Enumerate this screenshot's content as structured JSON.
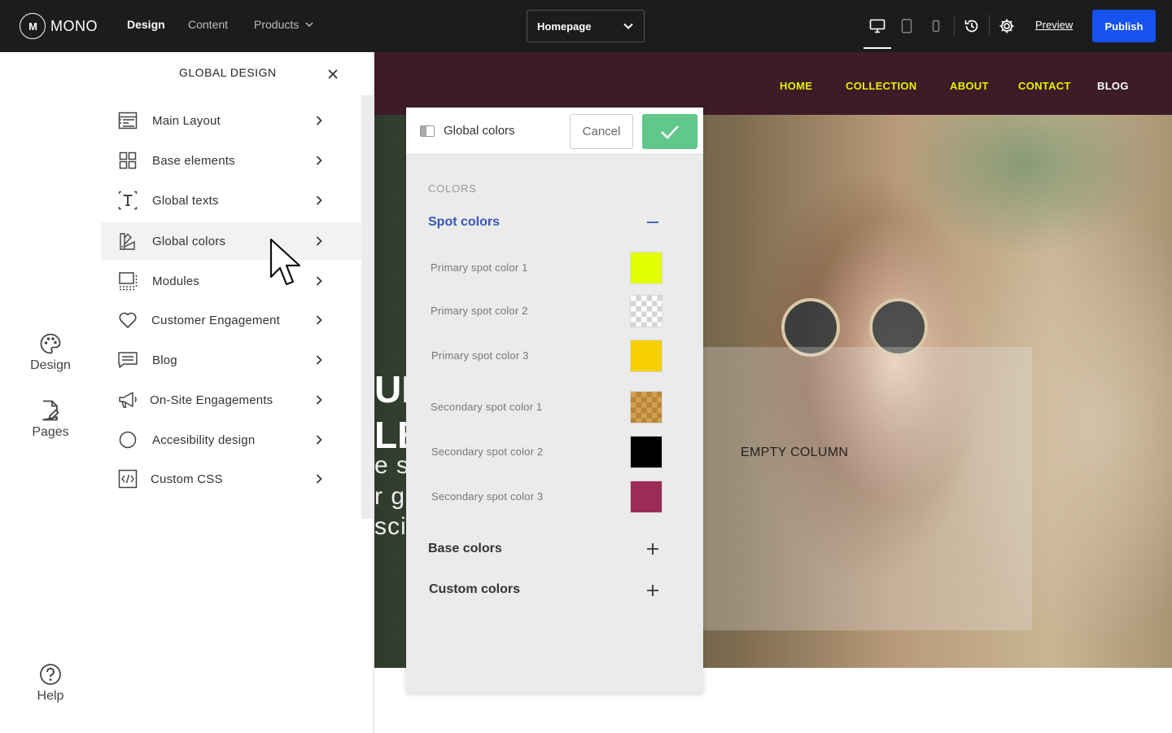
{
  "topbar": {
    "logo_mark": "M",
    "logo_text": "MONO",
    "tabs": [
      {
        "label": "Design",
        "active": true
      },
      {
        "label": "Content",
        "active": false
      },
      {
        "label": "Products",
        "active": false
      }
    ],
    "page_select_value": "Homepage",
    "devices": [
      "desktop-icon",
      "tablet-icon",
      "mobile-icon"
    ],
    "active_device": "desktop",
    "history_icon": "history-icon",
    "settings_icon": "gear-icon",
    "preview_label": "Preview",
    "publish_label": "Publish",
    "publish_color": "#1652f0"
  },
  "rail": {
    "design_label": "Design",
    "pages_label": "Pages",
    "help_label": "Help"
  },
  "global_design": {
    "title": "GLOBAL DESIGN",
    "items": [
      {
        "label": "Main Layout",
        "icon": "layout-icon"
      },
      {
        "label": "Base elements",
        "icon": "grid-icon"
      },
      {
        "label": "Global texts",
        "icon": "text-icon"
      },
      {
        "label": "Global colors",
        "icon": "color-swatch-icon",
        "active": true
      },
      {
        "label": "Modules",
        "icon": "modules-icon"
      },
      {
        "label": "Customer Engagement",
        "icon": "heart-icon"
      },
      {
        "label": "Blog",
        "icon": "chat-icon"
      },
      {
        "label": "On-Site Engagements",
        "icon": "megaphone-icon"
      },
      {
        "label": "Accesibility design",
        "icon": "circle-icon"
      },
      {
        "label": "Custom CSS",
        "icon": "code-icon"
      }
    ]
  },
  "site": {
    "nav": [
      "HOME",
      "COLLECTION",
      "ABOUT",
      "CONTACT",
      "BLOG"
    ],
    "nav_color": "#e2f400",
    "header_color": "#3d1b27",
    "hero_big_lines": [
      "UL",
      "LE"
    ],
    "hero_small_lines": [
      "e s",
      "r ge",
      "scie"
    ],
    "empty_column_label": "EMPTY COLUMN"
  },
  "global_colors": {
    "title": "Global colors",
    "cancel_label": "Cancel",
    "confirm_color": "#5fc88a",
    "section_label": "COLORS",
    "spot_colors": {
      "label": "Spot colors",
      "expanded": true,
      "items": [
        {
          "label": "Primary spot color 1",
          "color": "#e2ff00"
        },
        {
          "label": "Primary spot color 2",
          "color": "transparent"
        },
        {
          "label": "Primary spot color 3",
          "color": "#f5cf00"
        },
        {
          "label": "Secondary spot color 1",
          "color": "#c99945"
        },
        {
          "label": "Secondary spot color 2",
          "color": "#000000"
        },
        {
          "label": "Secondary spot color 3",
          "color": "#9b2c55"
        }
      ]
    },
    "base_colors": {
      "label": "Base colors",
      "expanded": false
    },
    "custom_colors": {
      "label": "Custom colors",
      "expanded": false
    }
  }
}
